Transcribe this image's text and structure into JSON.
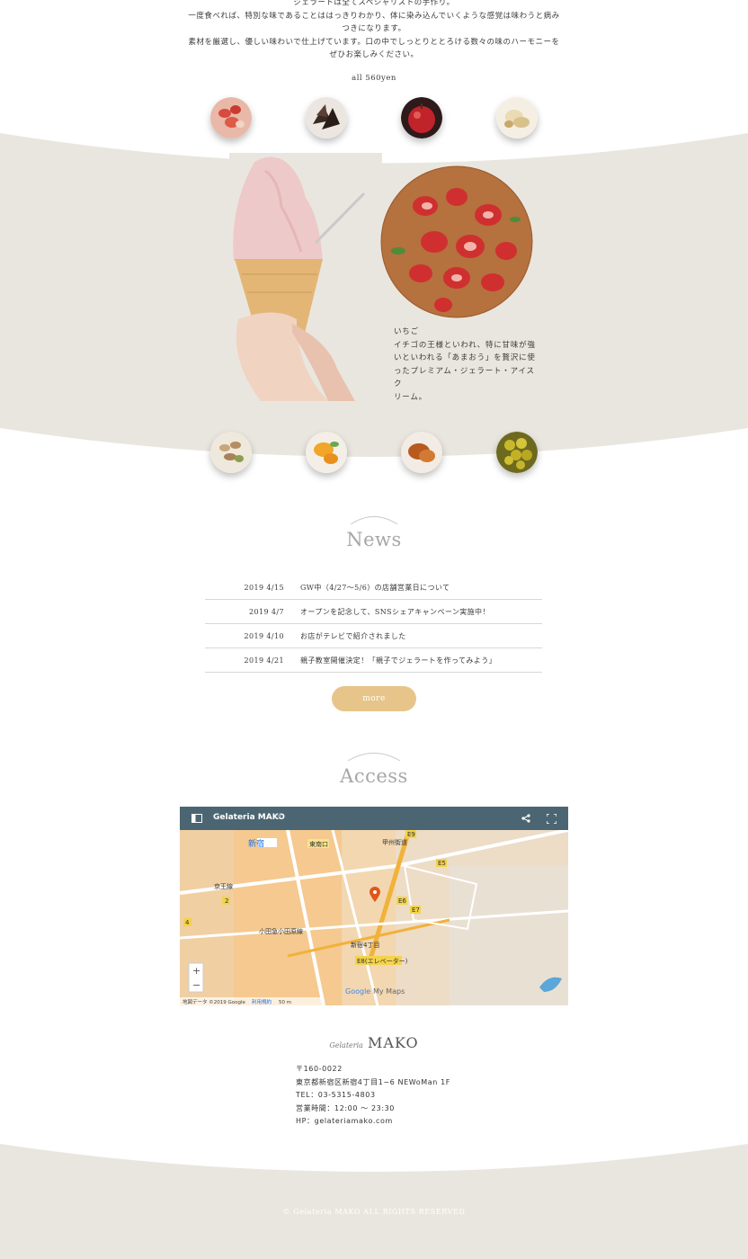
{
  "intro": {
    "lines": [
      "ジェラートは全てスペシャリストの手作り。",
      "一度食べれば、特別な味であることははっきりわかり、体に染み込んでいくような感覚は味わうと病み",
      "つきになります。",
      "素材を厳選し、優しい味わいで仕上げています。口の中でしっとりととろける数々の味のハーモニーを",
      "ぜひお楽しみください。"
    ],
    "price": "all 560yen"
  },
  "flavors_top": [
    "strawberry-icon",
    "chocolate-icon",
    "apple-icon",
    "banana-icon"
  ],
  "feature": {
    "name": "いちご",
    "desc_lines": [
      "イチゴの王様といわれ、特に甘味が強",
      "いといわれる「あまおう」を贅沢に使",
      "ったプレミアム・ジェラート・アイスク",
      "リーム。"
    ]
  },
  "flavors_bottom": [
    "pistachio-icon",
    "mango-icon",
    "caramel-icon",
    "citrus-icon"
  ],
  "news": {
    "title": "News",
    "items": [
      {
        "date": "2019 4/15",
        "text": "GW中（4/27〜5/6）の店舗営業日について"
      },
      {
        "date": "2019 4/7",
        "text": "オープンを記念して、SNSシェアキャンペーン実施中！"
      },
      {
        "date": "2019 4/10",
        "text": "お店がテレビで紹介されました"
      },
      {
        "date": "2019 4/21",
        "text": "親子教室開催決定！「親子でジェラートを作ってみよう」"
      }
    ],
    "more_label": "more"
  },
  "access": {
    "title": "Access",
    "map": {
      "title": "Gelateria MAKO",
      "labels": {
        "station": "新宿",
        "east_exit": "東南口",
        "koshu": "甲州街道",
        "e9": "E9",
        "e5": "E5",
        "e6": "E6",
        "e7": "E7",
        "n2": "2",
        "n4": "4",
        "elevator": "E8(エレベーター)",
        "shinjuku4": "新宿4丁目",
        "keio": "京王線",
        "odakyu": "小田急小田原線",
        "zoom_in": "+",
        "zoom_out": "−",
        "attribution": "地図データ ©2019 Google",
        "terms": "利用規約",
        "scale": "50 m",
        "google": "Google",
        "mymaps": "My Maps"
      }
    }
  },
  "shop": {
    "brand_small": "Gelateria",
    "brand_big": "MAKO",
    "postal": "〒160-0022",
    "address": "東京都新宿区新宿4丁目1−6 NEWoMan 1F",
    "tel": "TEL：03-5315-4803",
    "hours": "営業時間：12:00 〜 23:30",
    "hp": "HP：gelateriamako.com"
  },
  "footer": {
    "copyright": "© Gelateria MAKO ALL RIGHTS RESERVED"
  },
  "colors": {
    "beige": "#e9e6df",
    "accent": "#e7c58a",
    "title_gray": "#a7a7a7",
    "map_bar": "#4b6672"
  }
}
